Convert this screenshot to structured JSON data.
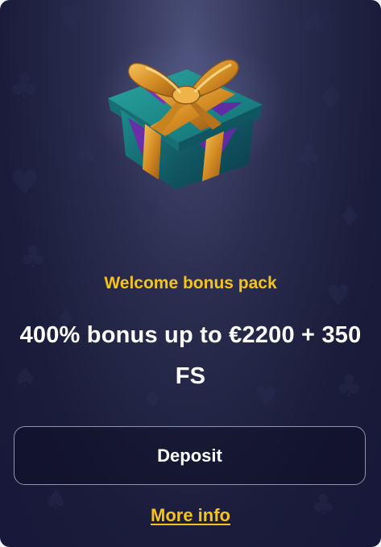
{
  "promo": {
    "subtitle": "Welcome bonus pack",
    "headline": "400% bonus up to €2200 + 350 FS",
    "deposit_label": "Deposit",
    "more_info_label": "More info"
  },
  "icons": {
    "gift": "gift-box-icon",
    "background_pattern": "card-suits-pattern"
  },
  "colors": {
    "background": "#1b1c3b",
    "accent": "#f6c318",
    "text": "#ffffff",
    "button_border": "#8f95a9"
  }
}
